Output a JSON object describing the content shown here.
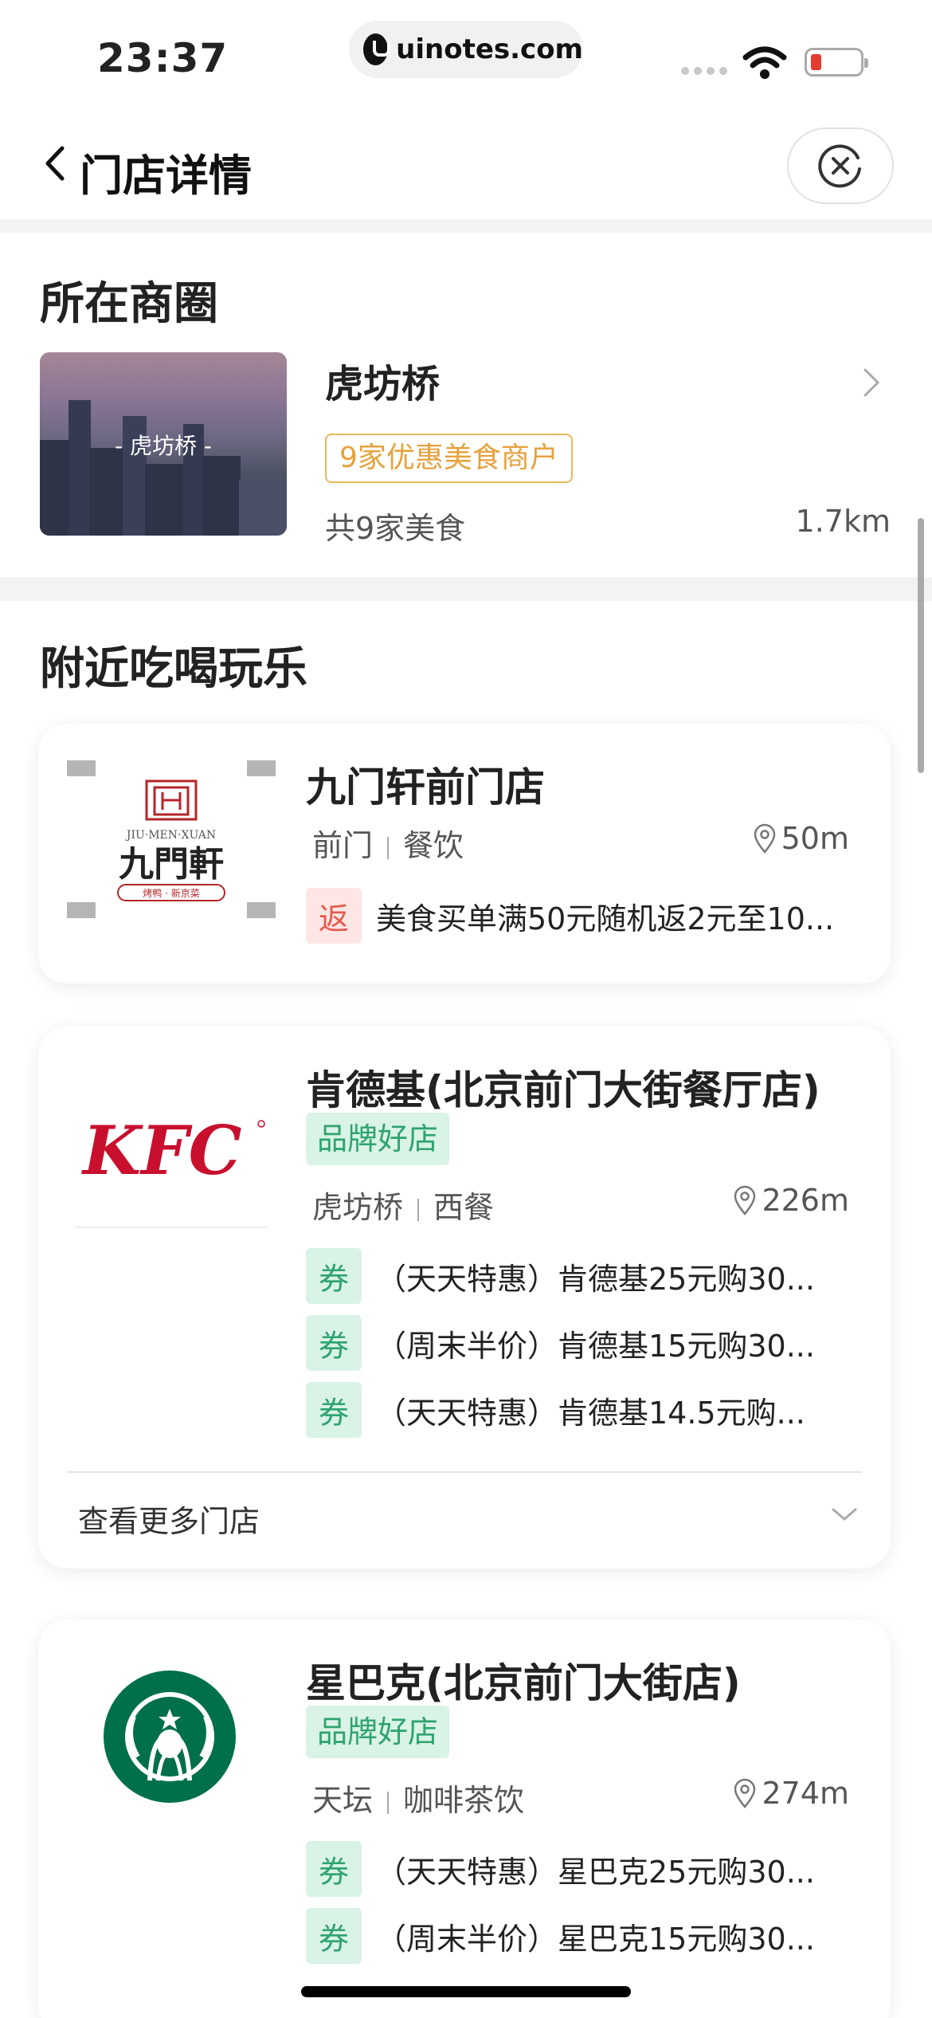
{
  "status_bar": {
    "time": "23:37",
    "url": "uinotes.com"
  },
  "nav": {
    "title": "门店详情"
  },
  "business_circle": {
    "section_title": "所在商圈",
    "image_label": "- 虎坊桥 -",
    "name": "虎坊桥",
    "tag": "9家优惠美食商户",
    "count_text": "共9家美食",
    "distance": "1.7km"
  },
  "nearby": {
    "section_title": "附近吃喝玩乐",
    "stores": [
      {
        "name": "九门轩前门店",
        "logo_text_top": "JIU·MEN·XUAN",
        "logo_text_main": "九門軒",
        "logo_text_sub": "烤鸭 · 新京菜",
        "area": "前门",
        "category": "餐饮",
        "distance": "50m",
        "deals": [
          {
            "badge": "返",
            "text": "美食买单满50元随机返2元至10..."
          }
        ]
      },
      {
        "name": "肯德基(北京前门大街餐厅店)",
        "logo_text_main": "KFC",
        "brand_tag": "品牌好店",
        "area": "虎坊桥",
        "category": "西餐",
        "distance": "226m",
        "deals": [
          {
            "badge": "券",
            "text": "（天天特惠）肯德基25元购30..."
          },
          {
            "badge": "券",
            "text": "（周末半价）肯德基15元购30..."
          },
          {
            "badge": "券",
            "text": "（天天特惠）肯德基14.5元购..."
          }
        ],
        "more_label": "查看更多门店"
      },
      {
        "name": "星巴克(北京前门大街店)",
        "brand_tag": "品牌好店",
        "area": "天坛",
        "category": "咖啡茶饮",
        "distance": "274m",
        "deals": [
          {
            "badge": "券",
            "text": "（天天特惠）星巴克25元购30..."
          },
          {
            "badge": "券",
            "text": "（周末半价）星巴克15元购30..."
          }
        ]
      }
    ]
  },
  "colors": {
    "accent_green": "#2fa36f",
    "tag_orange": "#e6a23c",
    "badge_red": "#e55a4e",
    "kfc_red": "#c8102e",
    "starbucks_green": "#00704a"
  },
  "icons": [
    "back-icon",
    "close-circle-icon",
    "chevron-right-icon",
    "location-pin-icon",
    "chevron-down-icon",
    "wifi-icon",
    "battery-icon"
  ]
}
